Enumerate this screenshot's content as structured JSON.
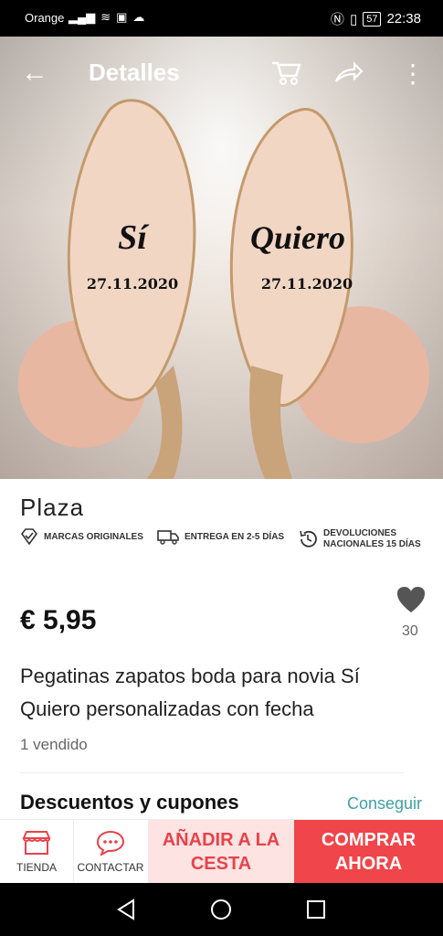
{
  "status_bar": {
    "carrier": "Orange",
    "battery": "57",
    "time": "22:38"
  },
  "header": {
    "title": "Detalles"
  },
  "hero": {
    "left_sole_text": "Sí",
    "right_sole_text": "Quiero",
    "date": "27.11.2020"
  },
  "seller": {
    "name": "Plaza",
    "badges": [
      {
        "text": "MARCAS ORIGINALES"
      },
      {
        "text": "ENTREGA EN 2-5 DÍAS"
      },
      {
        "line1": "DEVOLUCIONES",
        "line2": "NACIONALES 15 DÍAS"
      }
    ]
  },
  "product": {
    "price": "€ 5,95",
    "likes": "30",
    "title": "Pegatinas zapatos boda para novia Sí Quiero personalizadas con fecha",
    "sold": "1 vendido"
  },
  "discounts": {
    "label": "Descuentos y cupones",
    "link": "Conseguir"
  },
  "actions": {
    "store": "TIENDA",
    "contact": "CONTACTAR",
    "add_to_cart_line1": "AÑADIR A LA",
    "add_to_cart_line2": "CESTA",
    "buy_now_line1": "COMPRAR",
    "buy_now_line2": "AHORA"
  },
  "colors": {
    "accent": "#f0454a",
    "accent_light": "#fde4e2",
    "link": "#3f9fa6"
  }
}
